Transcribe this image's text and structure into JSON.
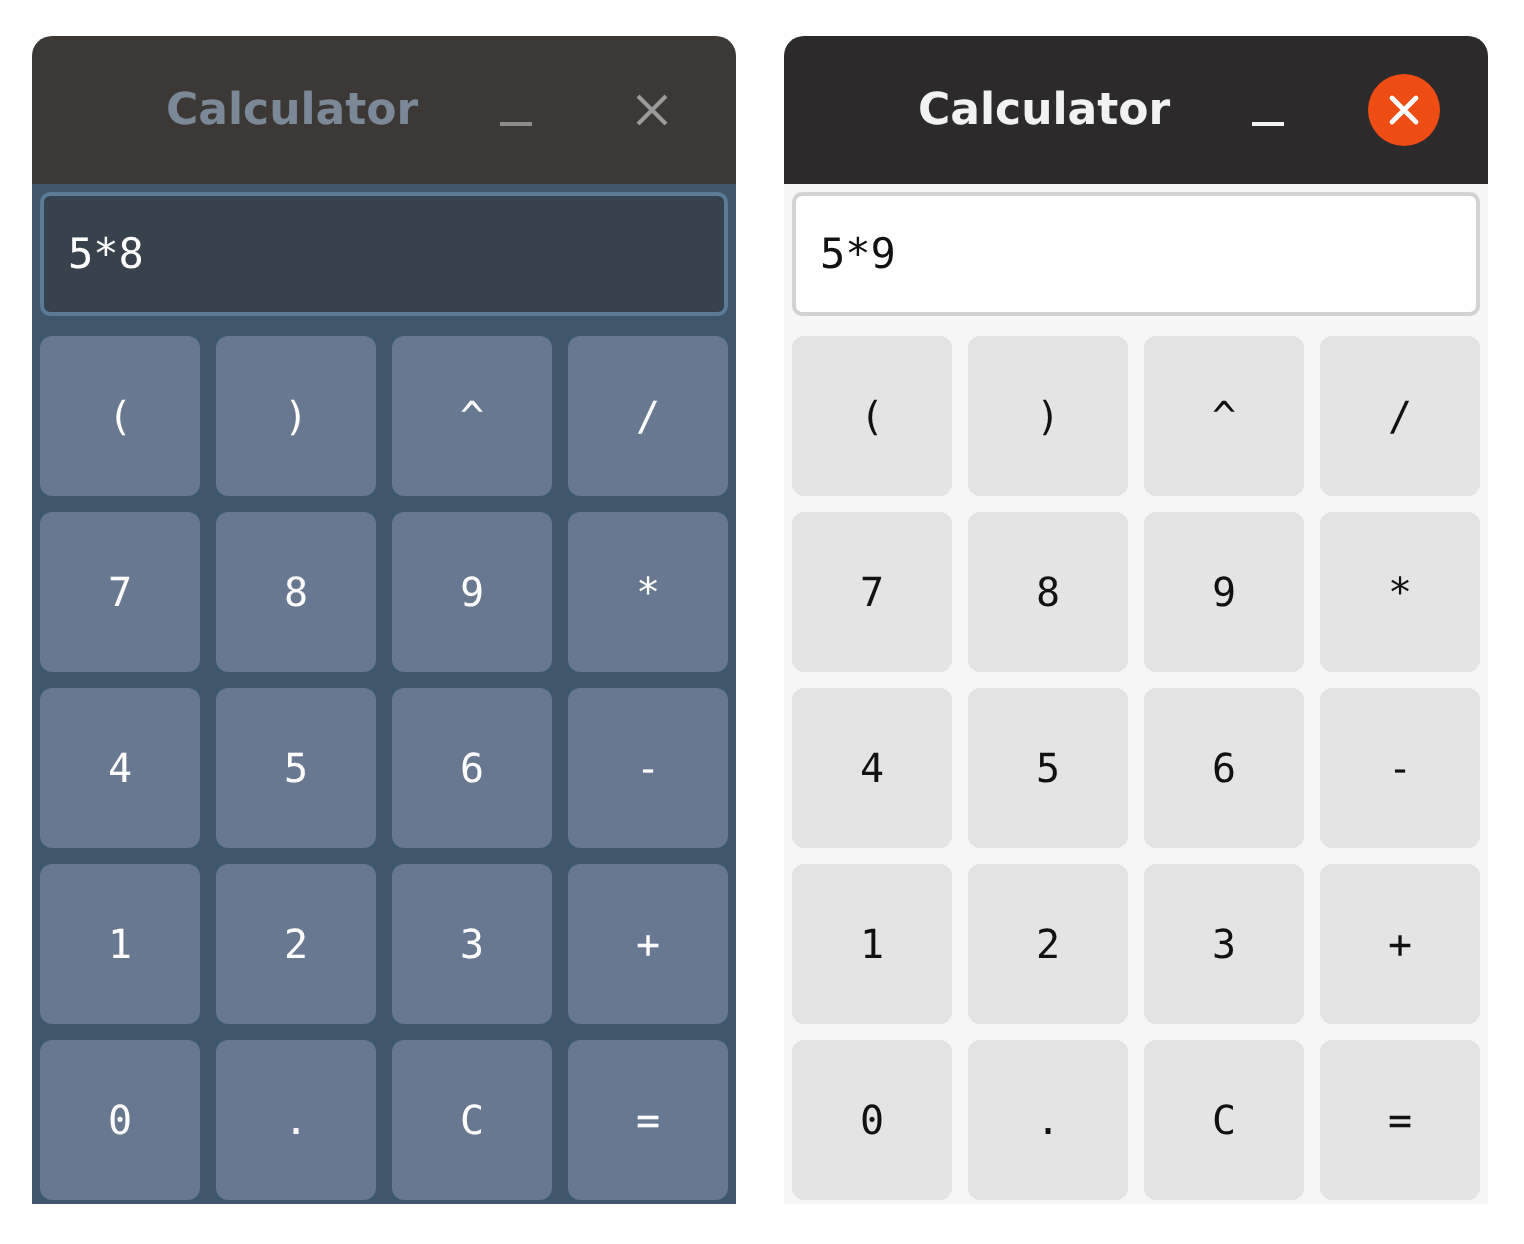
{
  "windows": [
    {
      "kind": "dark",
      "focused": false,
      "title": "Calculator",
      "display": {
        "value": "5*8"
      },
      "keys": [
        "(",
        ")",
        "^",
        "/",
        "7",
        "8",
        "9",
        "*",
        "4",
        "5",
        "6",
        "-",
        "1",
        "2",
        "3",
        "+",
        "0",
        ".",
        "C",
        "="
      ]
    },
    {
      "kind": "light",
      "focused": true,
      "title": "Calculator",
      "display": {
        "value": "5*9"
      },
      "keys": [
        "(",
        ")",
        "^",
        "/",
        "7",
        "8",
        "9",
        "*",
        "4",
        "5",
        "6",
        "-",
        "1",
        "2",
        "3",
        "+",
        "0",
        ".",
        "C",
        "="
      ]
    }
  ]
}
